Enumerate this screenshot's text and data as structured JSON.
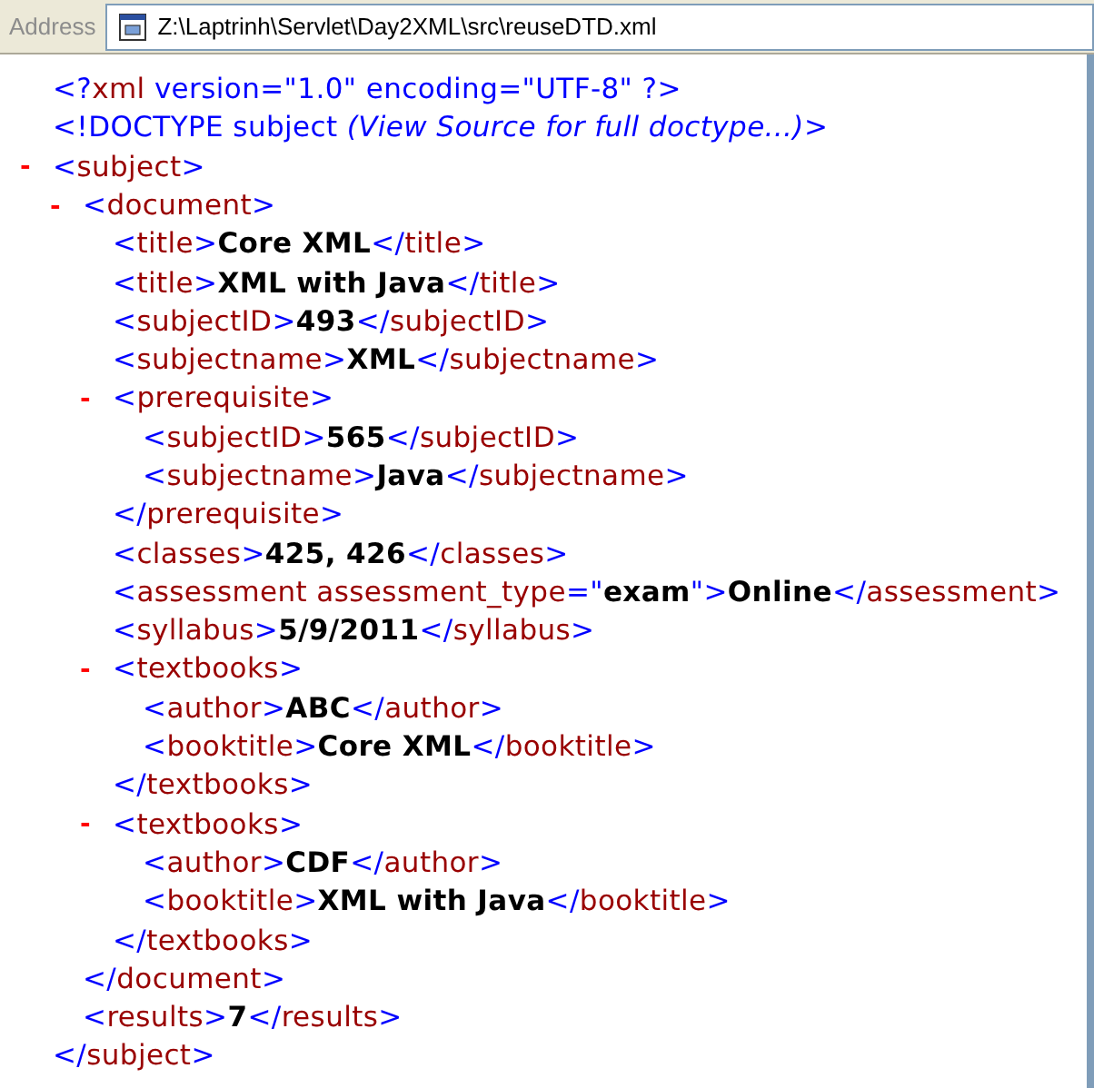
{
  "address_bar": {
    "label": "Address",
    "url": "Z:\\Laptrinh\\Servlet\\Day2XML\\src\\reuseDTD.xml"
  },
  "xml_view": [
    {
      "kind": "decl",
      "tokens": [
        {
          "kind": "markup",
          "text": "<?"
        },
        {
          "kind": "name",
          "text": "xml"
        },
        {
          "kind": "markup",
          "text": " version=\"1.0\" encoding=\"UTF-8\" ?>"
        }
      ]
    },
    {
      "kind": "decl",
      "tokens": [
        {
          "kind": "markup",
          "text": "<!DOCTYPE subject "
        },
        {
          "kind": "note",
          "text": "(View Source for full doctype...)"
        },
        {
          "kind": "markup",
          "text": ">"
        }
      ]
    },
    {
      "kind": "element",
      "toggle": "-",
      "expanded": true,
      "open": [
        {
          "kind": "markup",
          "text": "<"
        },
        {
          "kind": "name",
          "text": "subject"
        },
        {
          "kind": "markup",
          "text": ">"
        }
      ],
      "close": [
        {
          "kind": "markup",
          "text": "</"
        },
        {
          "kind": "name",
          "text": "subject"
        },
        {
          "kind": "markup",
          "text": ">"
        }
      ],
      "children": [
        {
          "kind": "element",
          "toggle": "-",
          "expanded": true,
          "open": [
            {
              "kind": "markup",
              "text": "<"
            },
            {
              "kind": "name",
              "text": "document"
            },
            {
              "kind": "markup",
              "text": ">"
            }
          ],
          "close": [
            {
              "kind": "markup",
              "text": "</"
            },
            {
              "kind": "name",
              "text": "document"
            },
            {
              "kind": "markup",
              "text": ">"
            }
          ],
          "children": [
            {
              "kind": "leaf",
              "tokens": [
                {
                  "kind": "markup",
                  "text": "<"
                },
                {
                  "kind": "name",
                  "text": "title"
                },
                {
                  "kind": "markup",
                  "text": ">"
                },
                {
                  "kind": "value",
                  "text": "Core XML"
                },
                {
                  "kind": "markup",
                  "text": "</"
                },
                {
                  "kind": "name",
                  "text": "title"
                },
                {
                  "kind": "markup",
                  "text": ">"
                }
              ]
            },
            {
              "kind": "leaf",
              "tokens": [
                {
                  "kind": "markup",
                  "text": "<"
                },
                {
                  "kind": "name",
                  "text": "title"
                },
                {
                  "kind": "markup",
                  "text": ">"
                },
                {
                  "kind": "value",
                  "text": "XML with Java"
                },
                {
                  "kind": "markup",
                  "text": "</"
                },
                {
                  "kind": "name",
                  "text": "title"
                },
                {
                  "kind": "markup",
                  "text": ">"
                }
              ]
            },
            {
              "kind": "leaf",
              "tokens": [
                {
                  "kind": "markup",
                  "text": "<"
                },
                {
                  "kind": "name",
                  "text": "subjectID"
                },
                {
                  "kind": "markup",
                  "text": ">"
                },
                {
                  "kind": "value",
                  "text": "493"
                },
                {
                  "kind": "markup",
                  "text": "</"
                },
                {
                  "kind": "name",
                  "text": "subjectID"
                },
                {
                  "kind": "markup",
                  "text": ">"
                }
              ]
            },
            {
              "kind": "leaf",
              "tokens": [
                {
                  "kind": "markup",
                  "text": "<"
                },
                {
                  "kind": "name",
                  "text": "subjectname"
                },
                {
                  "kind": "markup",
                  "text": ">"
                },
                {
                  "kind": "value",
                  "text": "XML"
                },
                {
                  "kind": "markup",
                  "text": "</"
                },
                {
                  "kind": "name",
                  "text": "subjectname"
                },
                {
                  "kind": "markup",
                  "text": ">"
                }
              ]
            },
            {
              "kind": "element",
              "toggle": "-",
              "expanded": true,
              "open": [
                {
                  "kind": "markup",
                  "text": "<"
                },
                {
                  "kind": "name",
                  "text": "prerequisite"
                },
                {
                  "kind": "markup",
                  "text": ">"
                }
              ],
              "close": [
                {
                  "kind": "markup",
                  "text": "</"
                },
                {
                  "kind": "name",
                  "text": "prerequisite"
                },
                {
                  "kind": "markup",
                  "text": ">"
                }
              ],
              "children": [
                {
                  "kind": "leaf",
                  "tokens": [
                    {
                      "kind": "markup",
                      "text": "<"
                    },
                    {
                      "kind": "name",
                      "text": "subjectID"
                    },
                    {
                      "kind": "markup",
                      "text": ">"
                    },
                    {
                      "kind": "value",
                      "text": "565"
                    },
                    {
                      "kind": "markup",
                      "text": "</"
                    },
                    {
                      "kind": "name",
                      "text": "subjectID"
                    },
                    {
                      "kind": "markup",
                      "text": ">"
                    }
                  ]
                },
                {
                  "kind": "leaf",
                  "tokens": [
                    {
                      "kind": "markup",
                      "text": "<"
                    },
                    {
                      "kind": "name",
                      "text": "subjectname"
                    },
                    {
                      "kind": "markup",
                      "text": ">"
                    },
                    {
                      "kind": "value",
                      "text": "Java"
                    },
                    {
                      "kind": "markup",
                      "text": "</"
                    },
                    {
                      "kind": "name",
                      "text": "subjectname"
                    },
                    {
                      "kind": "markup",
                      "text": ">"
                    }
                  ]
                }
              ]
            },
            {
              "kind": "leaf",
              "tokens": [
                {
                  "kind": "markup",
                  "text": "<"
                },
                {
                  "kind": "name",
                  "text": "classes"
                },
                {
                  "kind": "markup",
                  "text": ">"
                },
                {
                  "kind": "value",
                  "text": "425, 426"
                },
                {
                  "kind": "markup",
                  "text": "</"
                },
                {
                  "kind": "name",
                  "text": "classes"
                },
                {
                  "kind": "markup",
                  "text": ">"
                }
              ]
            },
            {
              "kind": "leaf",
              "tokens": [
                {
                  "kind": "markup",
                  "text": "<"
                },
                {
                  "kind": "name",
                  "text": "assessment assessment_type"
                },
                {
                  "kind": "markup",
                  "text": "=\""
                },
                {
                  "kind": "value",
                  "text": "exam"
                },
                {
                  "kind": "markup",
                  "text": "\">"
                },
                {
                  "kind": "value",
                  "text": "Online"
                },
                {
                  "kind": "markup",
                  "text": "</"
                },
                {
                  "kind": "name",
                  "text": "assessment"
                },
                {
                  "kind": "markup",
                  "text": ">"
                }
              ]
            },
            {
              "kind": "leaf",
              "tokens": [
                {
                  "kind": "markup",
                  "text": "<"
                },
                {
                  "kind": "name",
                  "text": "syllabus"
                },
                {
                  "kind": "markup",
                  "text": ">"
                },
                {
                  "kind": "value",
                  "text": "5/9/2011"
                },
                {
                  "kind": "markup",
                  "text": "</"
                },
                {
                  "kind": "name",
                  "text": "syllabus"
                },
                {
                  "kind": "markup",
                  "text": ">"
                }
              ]
            },
            {
              "kind": "element",
              "toggle": "-",
              "expanded": true,
              "open": [
                {
                  "kind": "markup",
                  "text": "<"
                },
                {
                  "kind": "name",
                  "text": "textbooks"
                },
                {
                  "kind": "markup",
                  "text": ">"
                }
              ],
              "close": [
                {
                  "kind": "markup",
                  "text": "</"
                },
                {
                  "kind": "name",
                  "text": "textbooks"
                },
                {
                  "kind": "markup",
                  "text": ">"
                }
              ],
              "children": [
                {
                  "kind": "leaf",
                  "tokens": [
                    {
                      "kind": "markup",
                      "text": "<"
                    },
                    {
                      "kind": "name",
                      "text": "author"
                    },
                    {
                      "kind": "markup",
                      "text": ">"
                    },
                    {
                      "kind": "value",
                      "text": "ABC"
                    },
                    {
                      "kind": "markup",
                      "text": "</"
                    },
                    {
                      "kind": "name",
                      "text": "author"
                    },
                    {
                      "kind": "markup",
                      "text": ">"
                    }
                  ]
                },
                {
                  "kind": "leaf",
                  "tokens": [
                    {
                      "kind": "markup",
                      "text": "<"
                    },
                    {
                      "kind": "name",
                      "text": "booktitle"
                    },
                    {
                      "kind": "markup",
                      "text": ">"
                    },
                    {
                      "kind": "value",
                      "text": "Core XML"
                    },
                    {
                      "kind": "markup",
                      "text": "</"
                    },
                    {
                      "kind": "name",
                      "text": "booktitle"
                    },
                    {
                      "kind": "markup",
                      "text": ">"
                    }
                  ]
                }
              ]
            },
            {
              "kind": "element",
              "toggle": "-",
              "expanded": true,
              "open": [
                {
                  "kind": "markup",
                  "text": "<"
                },
                {
                  "kind": "name",
                  "text": "textbooks"
                },
                {
                  "kind": "markup",
                  "text": ">"
                }
              ],
              "close": [
                {
                  "kind": "markup",
                  "text": "</"
                },
                {
                  "kind": "name",
                  "text": "textbooks"
                },
                {
                  "kind": "markup",
                  "text": ">"
                }
              ],
              "children": [
                {
                  "kind": "leaf",
                  "tokens": [
                    {
                      "kind": "markup",
                      "text": "<"
                    },
                    {
                      "kind": "name",
                      "text": "author"
                    },
                    {
                      "kind": "markup",
                      "text": ">"
                    },
                    {
                      "kind": "value",
                      "text": "CDF"
                    },
                    {
                      "kind": "markup",
                      "text": "</"
                    },
                    {
                      "kind": "name",
                      "text": "author"
                    },
                    {
                      "kind": "markup",
                      "text": ">"
                    }
                  ]
                },
                {
                  "kind": "leaf",
                  "tokens": [
                    {
                      "kind": "markup",
                      "text": "<"
                    },
                    {
                      "kind": "name",
                      "text": "booktitle"
                    },
                    {
                      "kind": "markup",
                      "text": ">"
                    },
                    {
                      "kind": "value",
                      "text": "XML with Java"
                    },
                    {
                      "kind": "markup",
                      "text": "</"
                    },
                    {
                      "kind": "name",
                      "text": "booktitle"
                    },
                    {
                      "kind": "markup",
                      "text": ">"
                    }
                  ]
                }
              ]
            }
          ]
        },
        {
          "kind": "leaf",
          "tokens": [
            {
              "kind": "markup",
              "text": "<"
            },
            {
              "kind": "name",
              "text": "results"
            },
            {
              "kind": "markup",
              "text": ">"
            },
            {
              "kind": "value",
              "text": "7"
            },
            {
              "kind": "markup",
              "text": "</"
            },
            {
              "kind": "name",
              "text": "results"
            },
            {
              "kind": "markup",
              "text": ">"
            }
          ]
        }
      ]
    }
  ]
}
